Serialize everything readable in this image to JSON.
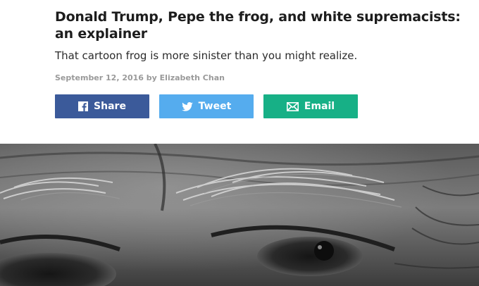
{
  "article": {
    "headline": "Donald Trump, Pepe the frog, and white supremacists: an explainer",
    "dek": "That cartoon frog is more sinister than you might realize.",
    "byline": "September 12, 2016 by Elizabeth Chan"
  },
  "share": {
    "facebook_label": "Share",
    "twitter_label": "Tweet",
    "email_label": "Email"
  },
  "colors": {
    "facebook": "#3b5a9a",
    "twitter": "#55acee",
    "email": "#17b086"
  },
  "hero_image": {
    "subject": "close-up black-and-white photo of eyes and eyebrows"
  }
}
